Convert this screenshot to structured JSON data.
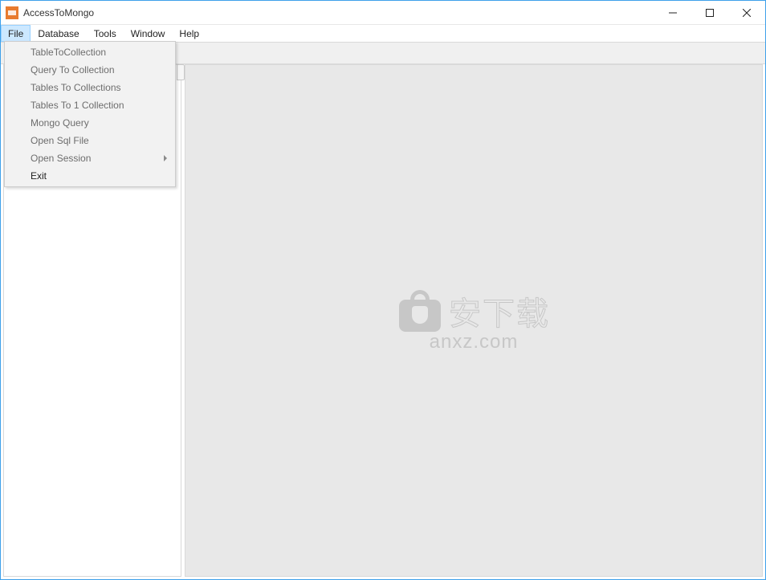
{
  "window": {
    "title": "AccessToMongo"
  },
  "menubar": {
    "items": [
      {
        "label": "File",
        "active": true
      },
      {
        "label": "Database",
        "active": false
      },
      {
        "label": "Tools",
        "active": false
      },
      {
        "label": "Window",
        "active": false
      },
      {
        "label": "Help",
        "active": false
      }
    ]
  },
  "file_menu": {
    "items": [
      {
        "label": "TableToCollection",
        "enabled": false,
        "submenu": false
      },
      {
        "label": "Query To Collection",
        "enabled": false,
        "submenu": false
      },
      {
        "label": "Tables To Collections",
        "enabled": false,
        "submenu": false
      },
      {
        "label": "Tables To 1 Collection",
        "enabled": false,
        "submenu": false
      },
      {
        "label": "Mongo Query",
        "enabled": false,
        "submenu": false
      },
      {
        "label": "Open Sql File",
        "enabled": false,
        "submenu": false
      },
      {
        "label": "Open Session",
        "enabled": false,
        "submenu": true
      },
      {
        "label": "Exit",
        "enabled": true,
        "submenu": false
      }
    ]
  },
  "watermark": {
    "cn": "安下载",
    "url": "anxz.com"
  }
}
